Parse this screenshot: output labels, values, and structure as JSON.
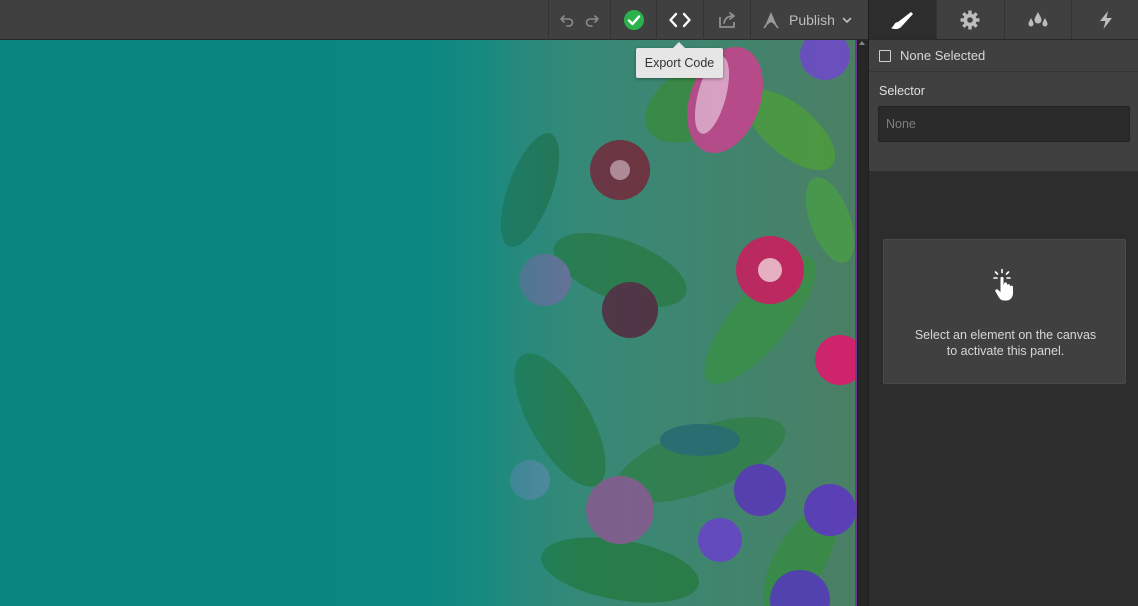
{
  "toolbar": {
    "undo_icon": "undo-icon",
    "redo_icon": "redo-icon",
    "status_icon": "check-circle-icon",
    "status_color": "#2bb24c",
    "export_icon": "code-brackets-icon",
    "share_icon": "share-icon",
    "publish_label": "Publish",
    "tooltip": "Export Code"
  },
  "panel": {
    "tabs": [
      {
        "name": "style",
        "icon": "brush-icon",
        "active": true
      },
      {
        "name": "settings",
        "icon": "gear-icon",
        "active": false
      },
      {
        "name": "style-manager",
        "icon": "drops-icon",
        "active": false
      },
      {
        "name": "interactions",
        "icon": "lightning-icon",
        "active": false
      }
    ],
    "none_selected_label": "None Selected",
    "selector_label": "Selector",
    "selector_placeholder": "None",
    "empty_message_line1": "Select an element on the canvas",
    "empty_message_line2": "to activate this panel."
  },
  "colors": {
    "canvas_teal": "#0b8680",
    "panel_bg": "#2d2d2d",
    "toolbar_bg": "#404040"
  }
}
